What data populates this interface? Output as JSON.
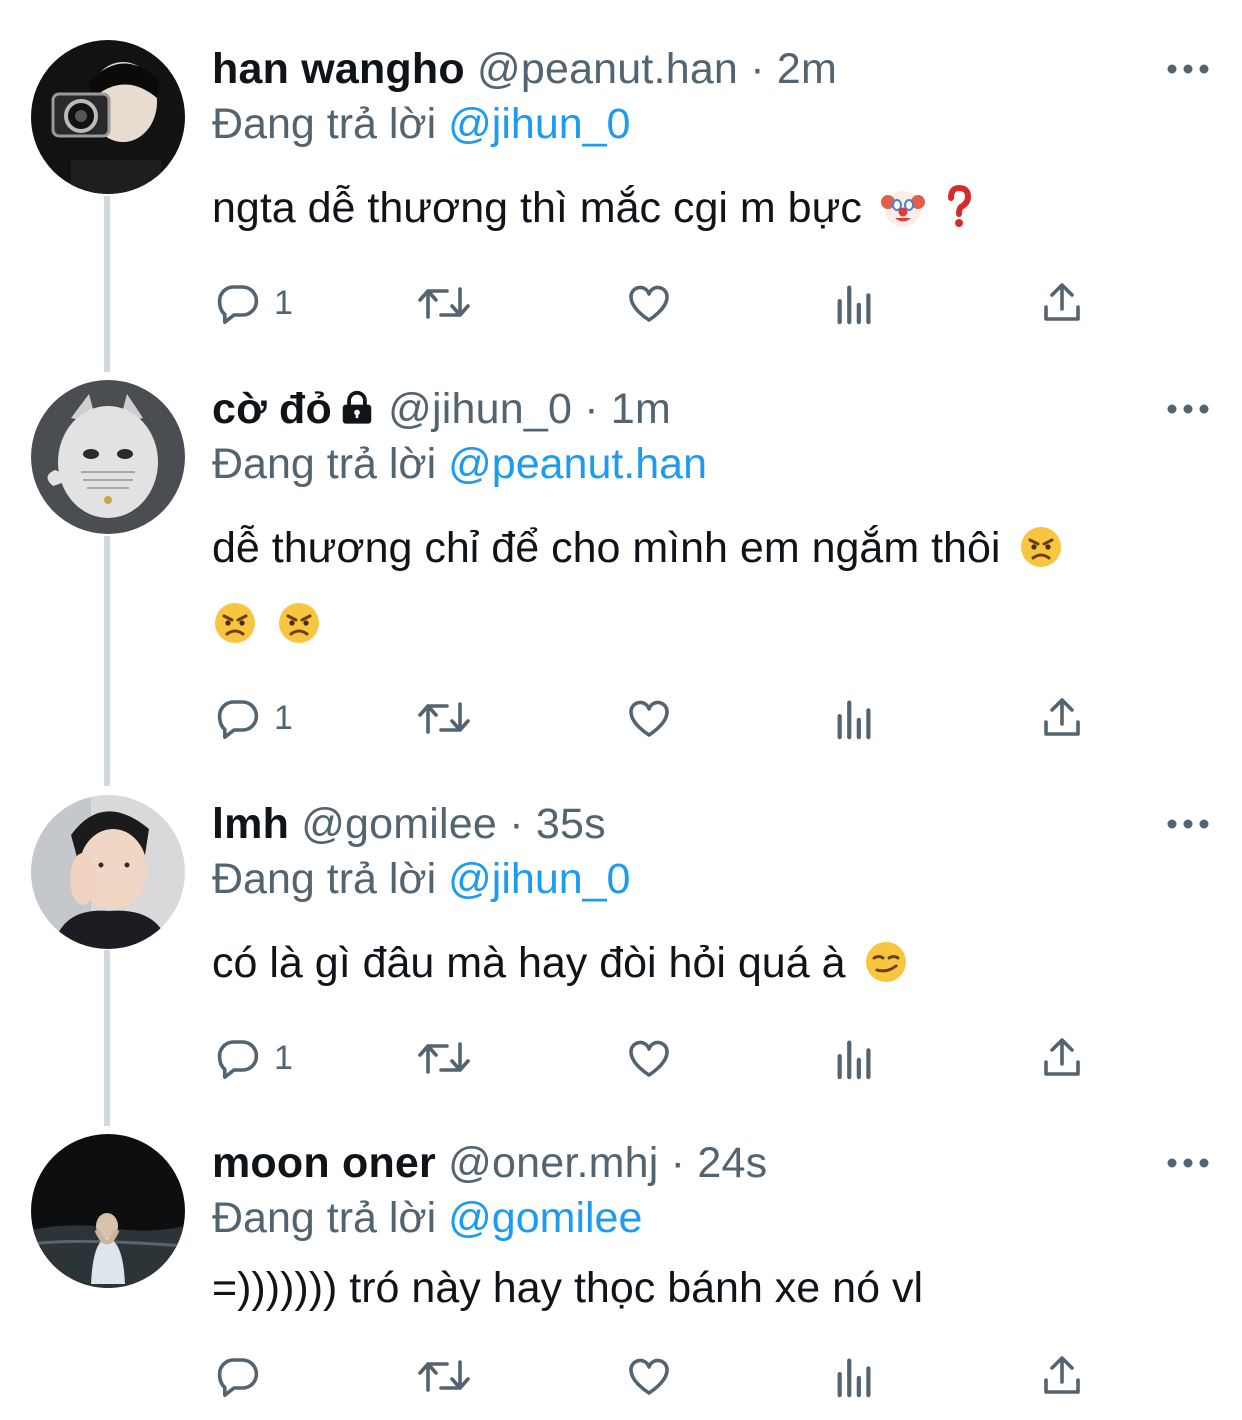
{
  "reply_prefix": "Đang trả lời",
  "tweets": [
    {
      "name": "han wangho",
      "handle": "@peanut.han",
      "separator": "·",
      "time": "2m",
      "reply_to": "@jihun_0",
      "text": "ngta dễ thương thì mắc cgi m bực",
      "text_line2": "",
      "reply_count": "1",
      "emojis": [
        "clown-face-emoji",
        "red-question-mark-emoji"
      ]
    },
    {
      "name": "cờ đỏ",
      "handle": "@jihun_0",
      "separator": "·",
      "time": "1m",
      "reply_to": "@peanut.han",
      "text": "dễ thương chỉ để cho mình em ngắm thôi",
      "text_line2": "",
      "reply_count": "1",
      "locked": true,
      "emojis": [
        "angry-face-emoji",
        "angry-face-emoji",
        "angry-face-emoji"
      ]
    },
    {
      "name": "lmh",
      "handle": "@gomilee",
      "separator": "·",
      "time": "35s",
      "reply_to": "@jihun_0",
      "text": "có là gì đâu mà hay đòi hỏi quá à",
      "text_line2": "",
      "reply_count": "1",
      "emojis": [
        "smirking-face-emoji"
      ]
    },
    {
      "name": "moon oner",
      "handle": "@oner.mhj",
      "separator": "·",
      "time": "24s",
      "reply_to": "@gomilee",
      "text": "=))))))) tró này hay thọc bánh xe nó vl",
      "text_line2": "",
      "reply_count": "",
      "emojis": []
    }
  ],
  "colors": {
    "text": "#0f1419",
    "secondary": "#536471",
    "link": "#1d9bf0",
    "thread_line": "#cfd9de"
  }
}
